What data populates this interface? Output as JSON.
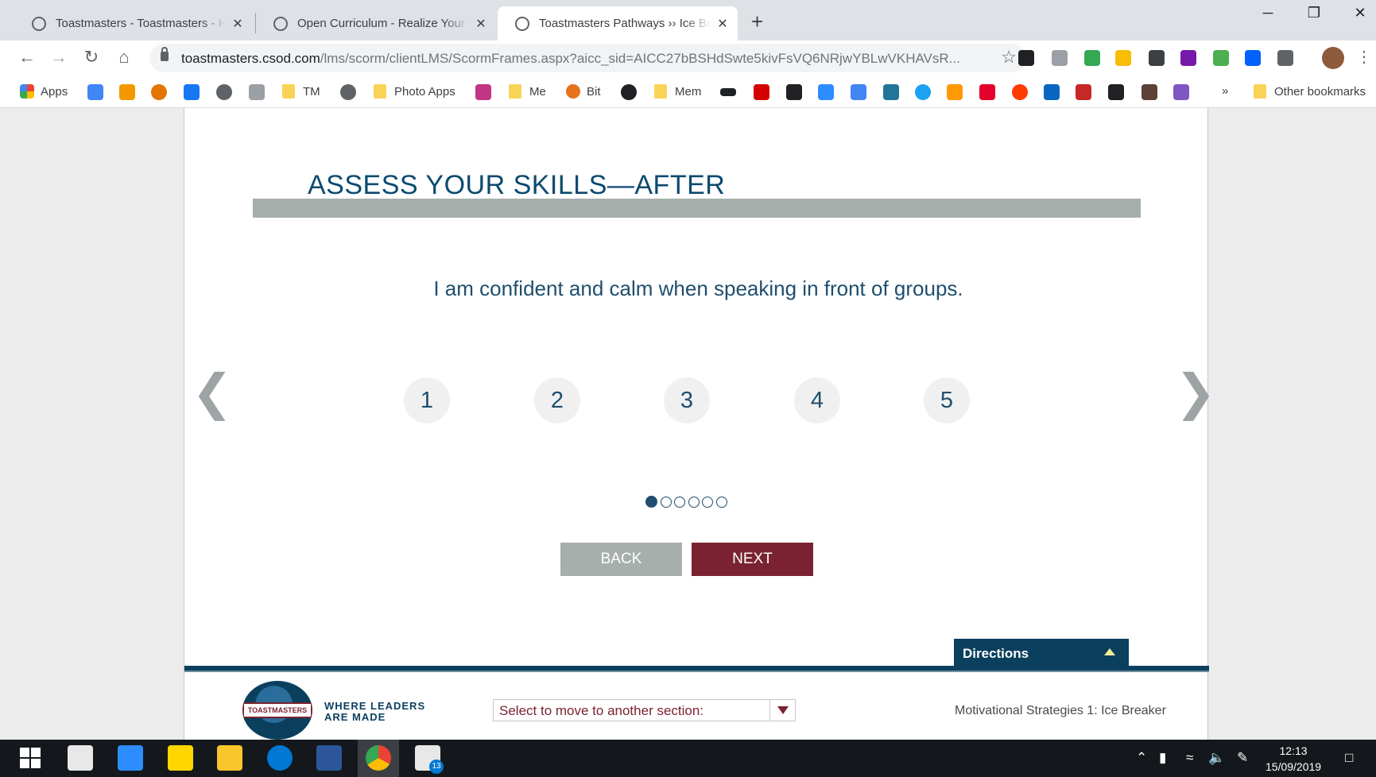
{
  "browser": {
    "tabs": [
      {
        "title": "Toastmasters - Toastmasters - Ha",
        "active": false
      },
      {
        "title": "Open Curriculum - Realize Your P",
        "active": false
      },
      {
        "title": "Toastmasters Pathways ›› Ice Brea",
        "active": true
      }
    ],
    "close_glyph": "✕",
    "new_tab_glyph": "+",
    "window_controls": {
      "minimize": "─",
      "restore": "❐",
      "close": "✕"
    },
    "url_host": "toastmasters.csod.com",
    "url_rest": "/lms/scorm/clientLMS/ScormFrames.aspx?aicc_sid=AICC27bBSHdSwte5kivFsVQ6NRjwYBLwVKHAVsR...",
    "bookmarks": {
      "apps": "Apps",
      "tm": "TM",
      "photo_apps": "Photo Apps",
      "me": "Me",
      "bit": "Bit",
      "mem": "Mem",
      "overflow": "»",
      "other": "Other bookmarks"
    }
  },
  "course": {
    "heading": "ASSESS YOUR SKILLS—AFTER",
    "statement": "I am confident and calm when speaking in front of groups.",
    "prev_arrow": "❮",
    "next_arrow": "❯",
    "ratings": [
      "1",
      "2",
      "3",
      "4",
      "5"
    ],
    "progress": {
      "current": 1,
      "total": 6
    },
    "back_label": "BACK",
    "next_label": "NEXT",
    "directions_label": "Directions",
    "logo_text": "TOASTMASTERS",
    "tagline_line1": "WHERE LEADERS",
    "tagline_line2": "ARE MADE",
    "section_select_placeholder": "Select to move to another section:",
    "course_name": "Motivational Strategies 1: Ice Breaker"
  },
  "taskbar": {
    "time": "12:13",
    "date": "15/09/2019",
    "mail_badge": "13"
  },
  "colors": {
    "heading": "#0b4a70",
    "next_button": "#7a2231",
    "back_button": "#a7afad",
    "footer_bar": "#0b3f5e"
  }
}
